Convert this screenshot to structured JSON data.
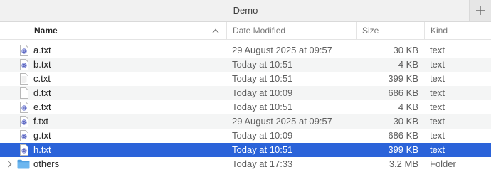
{
  "window": {
    "title": "Demo"
  },
  "columns": {
    "name": "Name",
    "date": "Date Modified",
    "size": "Size",
    "kind": "Kind"
  },
  "colors": {
    "selection": "#2b63d9",
    "folder": "#5aa9e6",
    "alt_row": "#f4f5f5"
  },
  "files": [
    {
      "name": "a.txt",
      "date": "29 August 2025 at 09:57",
      "size": "30 KB",
      "kind": "text",
      "icon": "textedit-doc-icon"
    },
    {
      "name": "b.txt",
      "date": "Today at 10:51",
      "size": "4 KB",
      "kind": "text",
      "icon": "textedit-doc-icon"
    },
    {
      "name": "c.txt",
      "date": "Today at 10:51",
      "size": "399 KB",
      "kind": "text",
      "icon": "plain-doc-icon"
    },
    {
      "name": "d.txt",
      "date": "Today at 10:09",
      "size": "686 KB",
      "kind": "text",
      "icon": "plain-doc-icon"
    },
    {
      "name": "e.txt",
      "date": "Today at 10:51",
      "size": "4 KB",
      "kind": "text",
      "icon": "textedit-doc-icon"
    },
    {
      "name": "f.txt",
      "date": "29 August 2025 at 09:57",
      "size": "30 KB",
      "kind": "text",
      "icon": "textedit-doc-icon"
    },
    {
      "name": "g.txt",
      "date": "Today at 10:09",
      "size": "686 KB",
      "kind": "text",
      "icon": "textedit-doc-icon"
    },
    {
      "name": "h.txt",
      "date": "Today at 10:51",
      "size": "399 KB",
      "kind": "text",
      "icon": "textedit-doc-icon"
    },
    {
      "name": "others",
      "date": "Today at 17:33",
      "size": "3.2 MB",
      "kind": "Folder",
      "icon": "folder-icon"
    }
  ]
}
